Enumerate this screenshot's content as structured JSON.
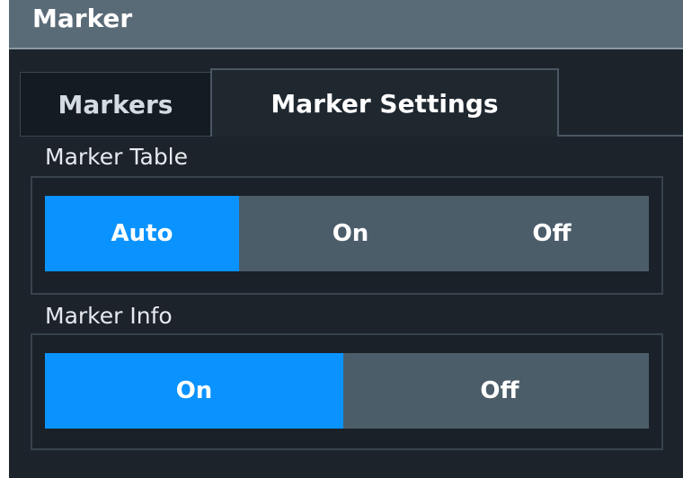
{
  "window": {
    "title": "Marker"
  },
  "tabs": [
    {
      "label": "Markers",
      "active": false
    },
    {
      "label": "Marker Settings",
      "active": true
    }
  ],
  "marker_table": {
    "label": "Marker Table",
    "options": [
      "Auto",
      "On",
      "Off"
    ],
    "selected": "Auto"
  },
  "marker_info": {
    "label": "Marker Info",
    "options": [
      "On",
      "Off"
    ],
    "selected": "On"
  },
  "colors": {
    "accent": "#0a93ff",
    "background": "#1c232b",
    "titlebar": "#5a6b78",
    "segment_background": "#4c5d6a"
  }
}
